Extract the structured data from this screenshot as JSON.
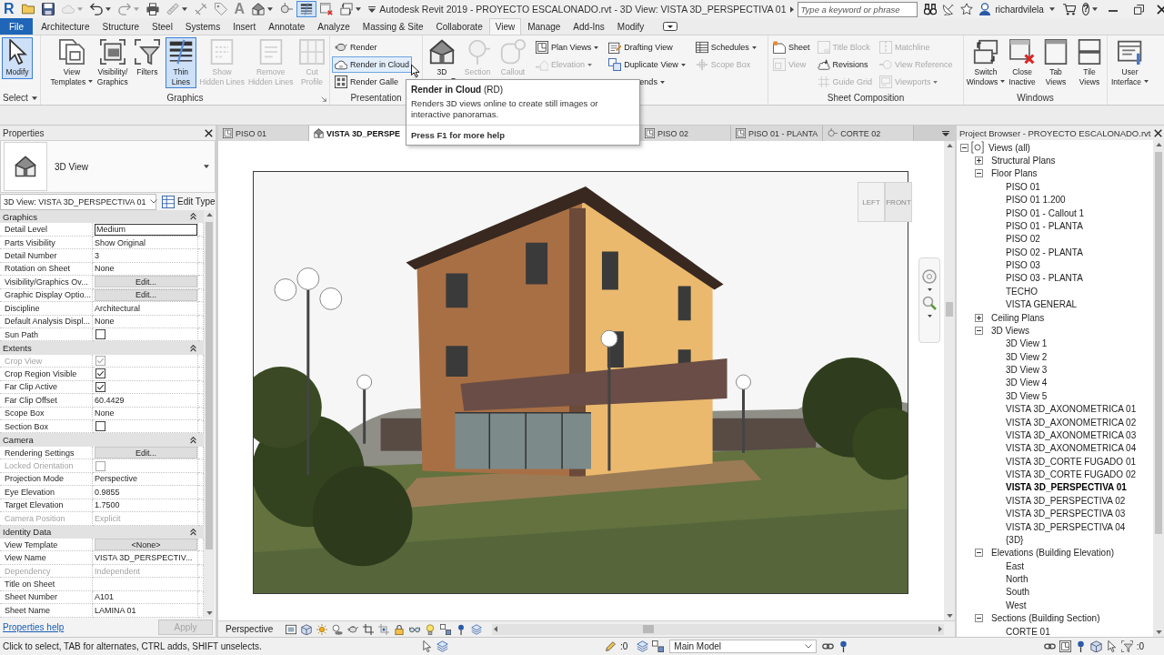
{
  "title_bar": {
    "logo": "R",
    "quick_access": [
      {
        "pressed": false,
        "disabled": false
      },
      {
        "pressed": false,
        "disabled": false
      },
      {
        "pressed": false,
        "disabled": true
      },
      {
        "pressed": false,
        "disabled": false
      },
      {
        "pressed": false,
        "disabled": true
      },
      {
        "pressed": false,
        "disabled": false
      },
      {
        "pressed": false,
        "disabled": false
      },
      {
        "pressed": false,
        "disabled": false
      },
      {
        "pressed": false,
        "disabled": false
      },
      {
        "label": "A",
        "pressed": false,
        "disabled": false
      },
      {
        "pressed": false,
        "disabled": false
      },
      {
        "pressed": false,
        "disabled": false
      },
      {
        "pressed": true,
        "disabled": false
      },
      {
        "pressed": false,
        "disabled": false
      },
      {
        "pressed": false,
        "disabled": false
      }
    ],
    "title": "Autodesk Revit 2019 - PROYECTO ESCALONADO.rvt - 3D View: VISTA 3D_PERSPECTIVA 01",
    "search": {
      "placeholder": "Type a keyword or phrase"
    },
    "user": "richardvilela",
    "help": "?"
  },
  "ribbon": {
    "tabs": [
      {
        "label": "File",
        "kind": "file",
        "selected": false
      },
      {
        "label": "Architecture",
        "kind": "tab",
        "selected": false
      },
      {
        "label": "Structure",
        "kind": "tab",
        "selected": false
      },
      {
        "label": "Steel",
        "kind": "tab",
        "selected": false
      },
      {
        "label": "Systems",
        "kind": "tab",
        "selected": false
      },
      {
        "label": "Insert",
        "kind": "tab",
        "selected": false
      },
      {
        "label": "Annotate",
        "kind": "tab",
        "selected": false
      },
      {
        "label": "Analyze",
        "kind": "tab",
        "selected": false
      },
      {
        "label": "Massing & Site",
        "kind": "tab",
        "selected": false
      },
      {
        "label": "Collaborate",
        "kind": "tab",
        "selected": false
      },
      {
        "label": "View",
        "kind": "tab",
        "selected": true
      },
      {
        "label": "Manage",
        "kind": "tab",
        "selected": false
      },
      {
        "label": "Add-Ins",
        "kind": "tab",
        "selected": false
      },
      {
        "label": "Modify",
        "kind": "tab",
        "selected": false
      }
    ],
    "panels": [
      {
        "title": "Select",
        "dropdown": true,
        "items": [
          {
            "kind": "large",
            "lines": [
              "Modify"
            ],
            "pressed": true,
            "hovered": false,
            "disabled": false
          }
        ]
      },
      {
        "title": "Graphics",
        "launcher": true,
        "items": [
          {
            "kind": "large",
            "lines": [
              "View",
              "Templates"
            ],
            "pressed": false,
            "hovered": false,
            "disabled": false,
            "dropdown": true
          },
          {
            "kind": "large",
            "lines": [
              "Visibility/",
              "Graphics"
            ],
            "pressed": false,
            "hovered": false,
            "disabled": false
          },
          {
            "kind": "large",
            "lines": [
              "Filters"
            ],
            "pressed": false,
            "hovered": false,
            "disabled": false
          },
          {
            "kind": "large",
            "lines": [
              "Thin",
              "Lines"
            ],
            "pressed": true,
            "hovered": false,
            "disabled": false
          },
          {
            "kind": "large",
            "lines": [
              "Show",
              "Hidden Lines"
            ],
            "pressed": false,
            "hovered": false,
            "disabled": true
          },
          {
            "kind": "large",
            "lines": [
              "Remove",
              "Hidden Lines"
            ],
            "pressed": false,
            "hovered": false,
            "disabled": true
          },
          {
            "kind": "large",
            "lines": [
              "Cut",
              "Profile"
            ],
            "pressed": false,
            "hovered": false,
            "disabled": true
          }
        ]
      },
      {
        "title": "Presentation",
        "items": [
          {
            "kind": "stack",
            "buttons": [
              {
                "label": "Render",
                "pressed": false,
                "hovered": false,
                "disabled": false
              },
              {
                "label": "Render in Cloud",
                "pressed": false,
                "hovered": true,
                "disabled": false
              },
              {
                "label": "Render Galle",
                "pressed": false,
                "hovered": false,
                "disabled": false
              }
            ]
          }
        ]
      },
      {
        "items": [
          {
            "kind": "large",
            "lines": [
              "3D"
            ],
            "pressed": false,
            "hovered": false,
            "disabled": false,
            "dropdown": true
          },
          {
            "kind": "large",
            "lines": [
              "Section"
            ],
            "pressed": false,
            "hovered": false,
            "disabled": true
          },
          {
            "kind": "large",
            "lines": [
              "Callout"
            ],
            "pressed": false,
            "hovered": false,
            "disabled": true
          },
          {
            "kind": "stack",
            "buttons": [
              {
                "label": "Plan Views",
                "pressed": false,
                "hovered": false,
                "disabled": false,
                "dropdown": true
              },
              {
                "label": "Elevation",
                "pressed": false,
                "hovered": false,
                "disabled": true,
                "dropdown": true
              }
            ]
          },
          {
            "kind": "stack",
            "buttons": [
              {
                "label": "Drafting View",
                "pressed": false,
                "hovered": false,
                "disabled": false
              },
              {
                "label": "Duplicate View",
                "pressed": false,
                "hovered": false,
                "disabled": false,
                "dropdown": true
              },
              {
                "label": "ends",
                "pressed": false,
                "hovered": false,
                "disabled": false,
                "dropdown": true
              }
            ]
          },
          {
            "kind": "stack",
            "buttons": [
              {
                "label": "Schedules",
                "pressed": false,
                "hovered": false,
                "disabled": false,
                "dropdown": true
              },
              {
                "label": "Scope Box",
                "pressed": false,
                "hovered": false,
                "disabled": true
              }
            ]
          }
        ]
      },
      {
        "title": "Sheet Composition",
        "items": [
          {
            "kind": "stack",
            "buttons": [
              {
                "label": "Sheet",
                "pressed": false,
                "hovered": false,
                "disabled": false
              },
              {
                "label": "View",
                "pressed": false,
                "hovered": false,
                "disabled": true
              }
            ]
          },
          {
            "kind": "stack",
            "buttons": [
              {
                "label": "Title Block",
                "pressed": false,
                "hovered": false,
                "disabled": true
              },
              {
                "label": "Revisions",
                "pressed": false,
                "hovered": false,
                "disabled": false
              },
              {
                "label": "Guide Grid",
                "pressed": false,
                "hovered": false,
                "disabled": true
              }
            ]
          },
          {
            "kind": "stack",
            "buttons": [
              {
                "label": "Matchline",
                "pressed": false,
                "hovered": false,
                "disabled": true
              },
              {
                "label": "View Reference",
                "pressed": false,
                "hovered": false,
                "disabled": true
              },
              {
                "label": "Viewports",
                "pressed": false,
                "hovered": false,
                "disabled": true,
                "dropdown": true
              }
            ]
          }
        ]
      },
      {
        "title": "Windows",
        "items": [
          {
            "kind": "large",
            "lines": [
              "Switch",
              "Windows"
            ],
            "pressed": false,
            "hovered": false,
            "disabled": false,
            "dropdown": true
          },
          {
            "kind": "large",
            "lines": [
              "Close",
              "Inactive"
            ],
            "pressed": false,
            "hovered": false,
            "disabled": false
          },
          {
            "kind": "large",
            "lines": [
              "Tab",
              "Views"
            ],
            "pressed": false,
            "hovered": false,
            "disabled": false
          },
          {
            "kind": "large",
            "lines": [
              "Tile",
              "Views"
            ],
            "pressed": false,
            "hovered": false,
            "disabled": false
          }
        ]
      },
      {
        "items": [
          {
            "kind": "large",
            "lines": [
              "User",
              "Interface"
            ],
            "pressed": false,
            "hovered": false,
            "disabled": false,
            "dropdown": true
          }
        ]
      }
    ]
  },
  "tooltip": {
    "title": "**Render in Cloud** (RD)",
    "description": "Renders 3D views online to create still images or interactive panoramas.",
    "help": "Press F1 for more help"
  },
  "properties": {
    "title": "Properties",
    "type_name": "3D View",
    "instance": "3D View: VISTA 3D_PERSPECTIVA 01",
    "edit_type": "Edit Type",
    "groups": [
      {
        "name": "Graphics",
        "expanded": true,
        "rows": [
          {
            "name": "Detail Level",
            "kind": "field",
            "value": "Medium",
            "disabled": false
          },
          {
            "name": "Parts Visibility",
            "kind": "text",
            "value": "Show Original",
            "disabled": false
          },
          {
            "name": "Detail Number",
            "kind": "text",
            "value": "3",
            "disabled": false
          },
          {
            "name": "Rotation on Sheet",
            "kind": "text",
            "value": "None",
            "disabled": false
          },
          {
            "name": "Visibility/Graphics Ov...",
            "kind": "button",
            "value": "Edit...",
            "disabled": false
          },
          {
            "name": "Graphic Display Optio...",
            "kind": "button",
            "value": "Edit...",
            "disabled": false
          },
          {
            "name": "Discipline",
            "kind": "text",
            "value": "Architectural",
            "disabled": false
          },
          {
            "name": "Default Analysis Displ...",
            "kind": "text",
            "value": "None",
            "disabled": false
          },
          {
            "name": "Sun Path",
            "kind": "checkbox",
            "checked": false,
            "disabled": false
          }
        ]
      },
      {
        "name": "Extents",
        "expanded": true,
        "rows": [
          {
            "name": "Crop View",
            "kind": "checkbox",
            "checked": true,
            "disabled": true
          },
          {
            "name": "Crop Region Visible",
            "kind": "checkbox",
            "checked": true,
            "disabled": false
          },
          {
            "name": "Far Clip Active",
            "kind": "checkbox",
            "checked": true,
            "disabled": false
          },
          {
            "name": "Far Clip Offset",
            "kind": "text",
            "value": "60.4429",
            "disabled": false
          },
          {
            "name": "Scope Box",
            "kind": "text",
            "value": "None",
            "disabled": false
          },
          {
            "name": "Section Box",
            "kind": "checkbox",
            "checked": false,
            "disabled": false
          }
        ]
      },
      {
        "name": "Camera",
        "expanded": true,
        "rows": [
          {
            "name": "Rendering Settings",
            "kind": "button",
            "value": "Edit...",
            "disabled": false
          },
          {
            "name": "Locked Orientation",
            "kind": "checkbox",
            "checked": false,
            "disabled": true
          },
          {
            "name": "Projection Mode",
            "kind": "text",
            "value": "Perspective",
            "disabled": false
          },
          {
            "name": "Eye Elevation",
            "kind": "text",
            "value": "0.9855",
            "disabled": false
          },
          {
            "name": "Target Elevation",
            "kind": "text",
            "value": "1.7500",
            "disabled": false
          },
          {
            "name": "Camera Position",
            "kind": "text",
            "value": "Explicit",
            "disabled": true
          }
        ]
      },
      {
        "name": "Identity Data",
        "expanded": true,
        "rows": [
          {
            "name": "View Template",
            "kind": "button",
            "value": "<None>",
            "disabled": false
          },
          {
            "name": "View Name",
            "kind": "text",
            "value": "VISTA 3D_PERSPECTIV...",
            "disabled": false
          },
          {
            "name": "Dependency",
            "kind": "text",
            "value": "Independent",
            "disabled": true
          },
          {
            "name": "Title on Sheet",
            "kind": "text",
            "disabled": false
          },
          {
            "name": "Sheet Number",
            "kind": "text",
            "value": "A101",
            "disabled": false
          },
          {
            "name": "Sheet Name",
            "kind": "text",
            "value": "LAMINA 01",
            "disabled": false
          }
        ]
      }
    ],
    "help": "Properties help",
    "apply": {
      "label": "Apply",
      "disabled": true
    }
  },
  "view_tabs": [
    {
      "label": "PISO 01",
      "selected": false
    },
    {
      "label": "VISTA 3D_PERSPE",
      "selected": true
    },
    {
      "label": "PISO 02",
      "selected": false
    },
    {
      "label": "PISO 01 - PLANTA",
      "selected": false
    },
    {
      "label": "CORTE 02",
      "selected": false
    }
  ],
  "viewport": {
    "view_cube": [
      "LEFT",
      "FRONT"
    ],
    "control_bar": {
      "label": "Perspective"
    }
  },
  "project_browser": {
    "title": "Project Browser - PROYECTO ESCALONADO.rvt",
    "tree": [
      {
        "label": "Views (all)",
        "expanded": true,
        "selected": false,
        "children": [
          {
            "label": "Structural Plans",
            "expanded": false,
            "selected": false
          },
          {
            "label": "Floor Plans",
            "expanded": true,
            "selected": false,
            "children": [
              {
                "label": "PISO 01",
                "selected": false
              },
              {
                "label": "PISO 01 1.200",
                "selected": false
              },
              {
                "label": "PISO 01 - Callout 1",
                "selected": false
              },
              {
                "label": "PISO 01 - PLANTA",
                "selected": false
              },
              {
                "label": "PISO 02",
                "selected": false
              },
              {
                "label": "PISO 02 - PLANTA",
                "selected": false
              },
              {
                "label": "PISO 03",
                "selected": false
              },
              {
                "label": "PISO 03 - PLANTA",
                "selected": false
              },
              {
                "label": "TECHO",
                "selected": false
              },
              {
                "label": "VISTA GENERAL",
                "selected": false
              }
            ]
          },
          {
            "label": "Ceiling Plans",
            "expanded": false,
            "selected": false
          },
          {
            "label": "3D Views",
            "expanded": true,
            "selected": false,
            "children": [
              {
                "label": "3D View 1",
                "selected": false
              },
              {
                "label": "3D View 2",
                "selected": false
              },
              {
                "label": "3D View 3",
                "selected": false
              },
              {
                "label": "3D View 4",
                "selected": false
              },
              {
                "label": "3D View 5",
                "selected": false
              },
              {
                "label": "VISTA 3D_AXONOMETRICA 01",
                "selected": false
              },
              {
                "label": "VISTA 3D_AXONOMETRICA 02",
                "selected": false
              },
              {
                "label": "VISTA 3D_AXONOMETRICA 03",
                "selected": false
              },
              {
                "label": "VISTA 3D_AXONOMETRICA 04",
                "selected": false
              },
              {
                "label": "VISTA 3D_CORTE FUGADO 01",
                "selected": false
              },
              {
                "label": "VISTA 3D_CORTE FUGADO 02",
                "selected": false
              },
              {
                "label": "VISTA 3D_PERSPECTIVA 01",
                "selected": true
              },
              {
                "label": "VISTA 3D_PERSPECTIVA 02",
                "selected": false
              },
              {
                "label": "VISTA 3D_PERSPECTIVA 03",
                "selected": false
              },
              {
                "label": "VISTA 3D_PERSPECTIVA 04",
                "selected": false
              },
              {
                "label": "{3D}",
                "selected": false
              }
            ]
          },
          {
            "label": "Elevations (Building Elevation)",
            "expanded": true,
            "selected": false,
            "children": [
              {
                "label": "East",
                "selected": false
              },
              {
                "label": "North",
                "selected": false
              },
              {
                "label": "South",
                "selected": false
              },
              {
                "label": "West",
                "selected": false
              }
            ]
          },
          {
            "label": "Sections (Building Section)",
            "expanded": true,
            "selected": false,
            "children": [
              {
                "label": "CORTE 01",
                "selected": false
              }
            ]
          }
        ]
      }
    ]
  },
  "status_bar": {
    "message": "Click to select, TAB for alternates, CTRL adds, SHIFT unselects.",
    "editable_count": ":0",
    "model": "Main Model",
    "filter_count": ":0"
  }
}
